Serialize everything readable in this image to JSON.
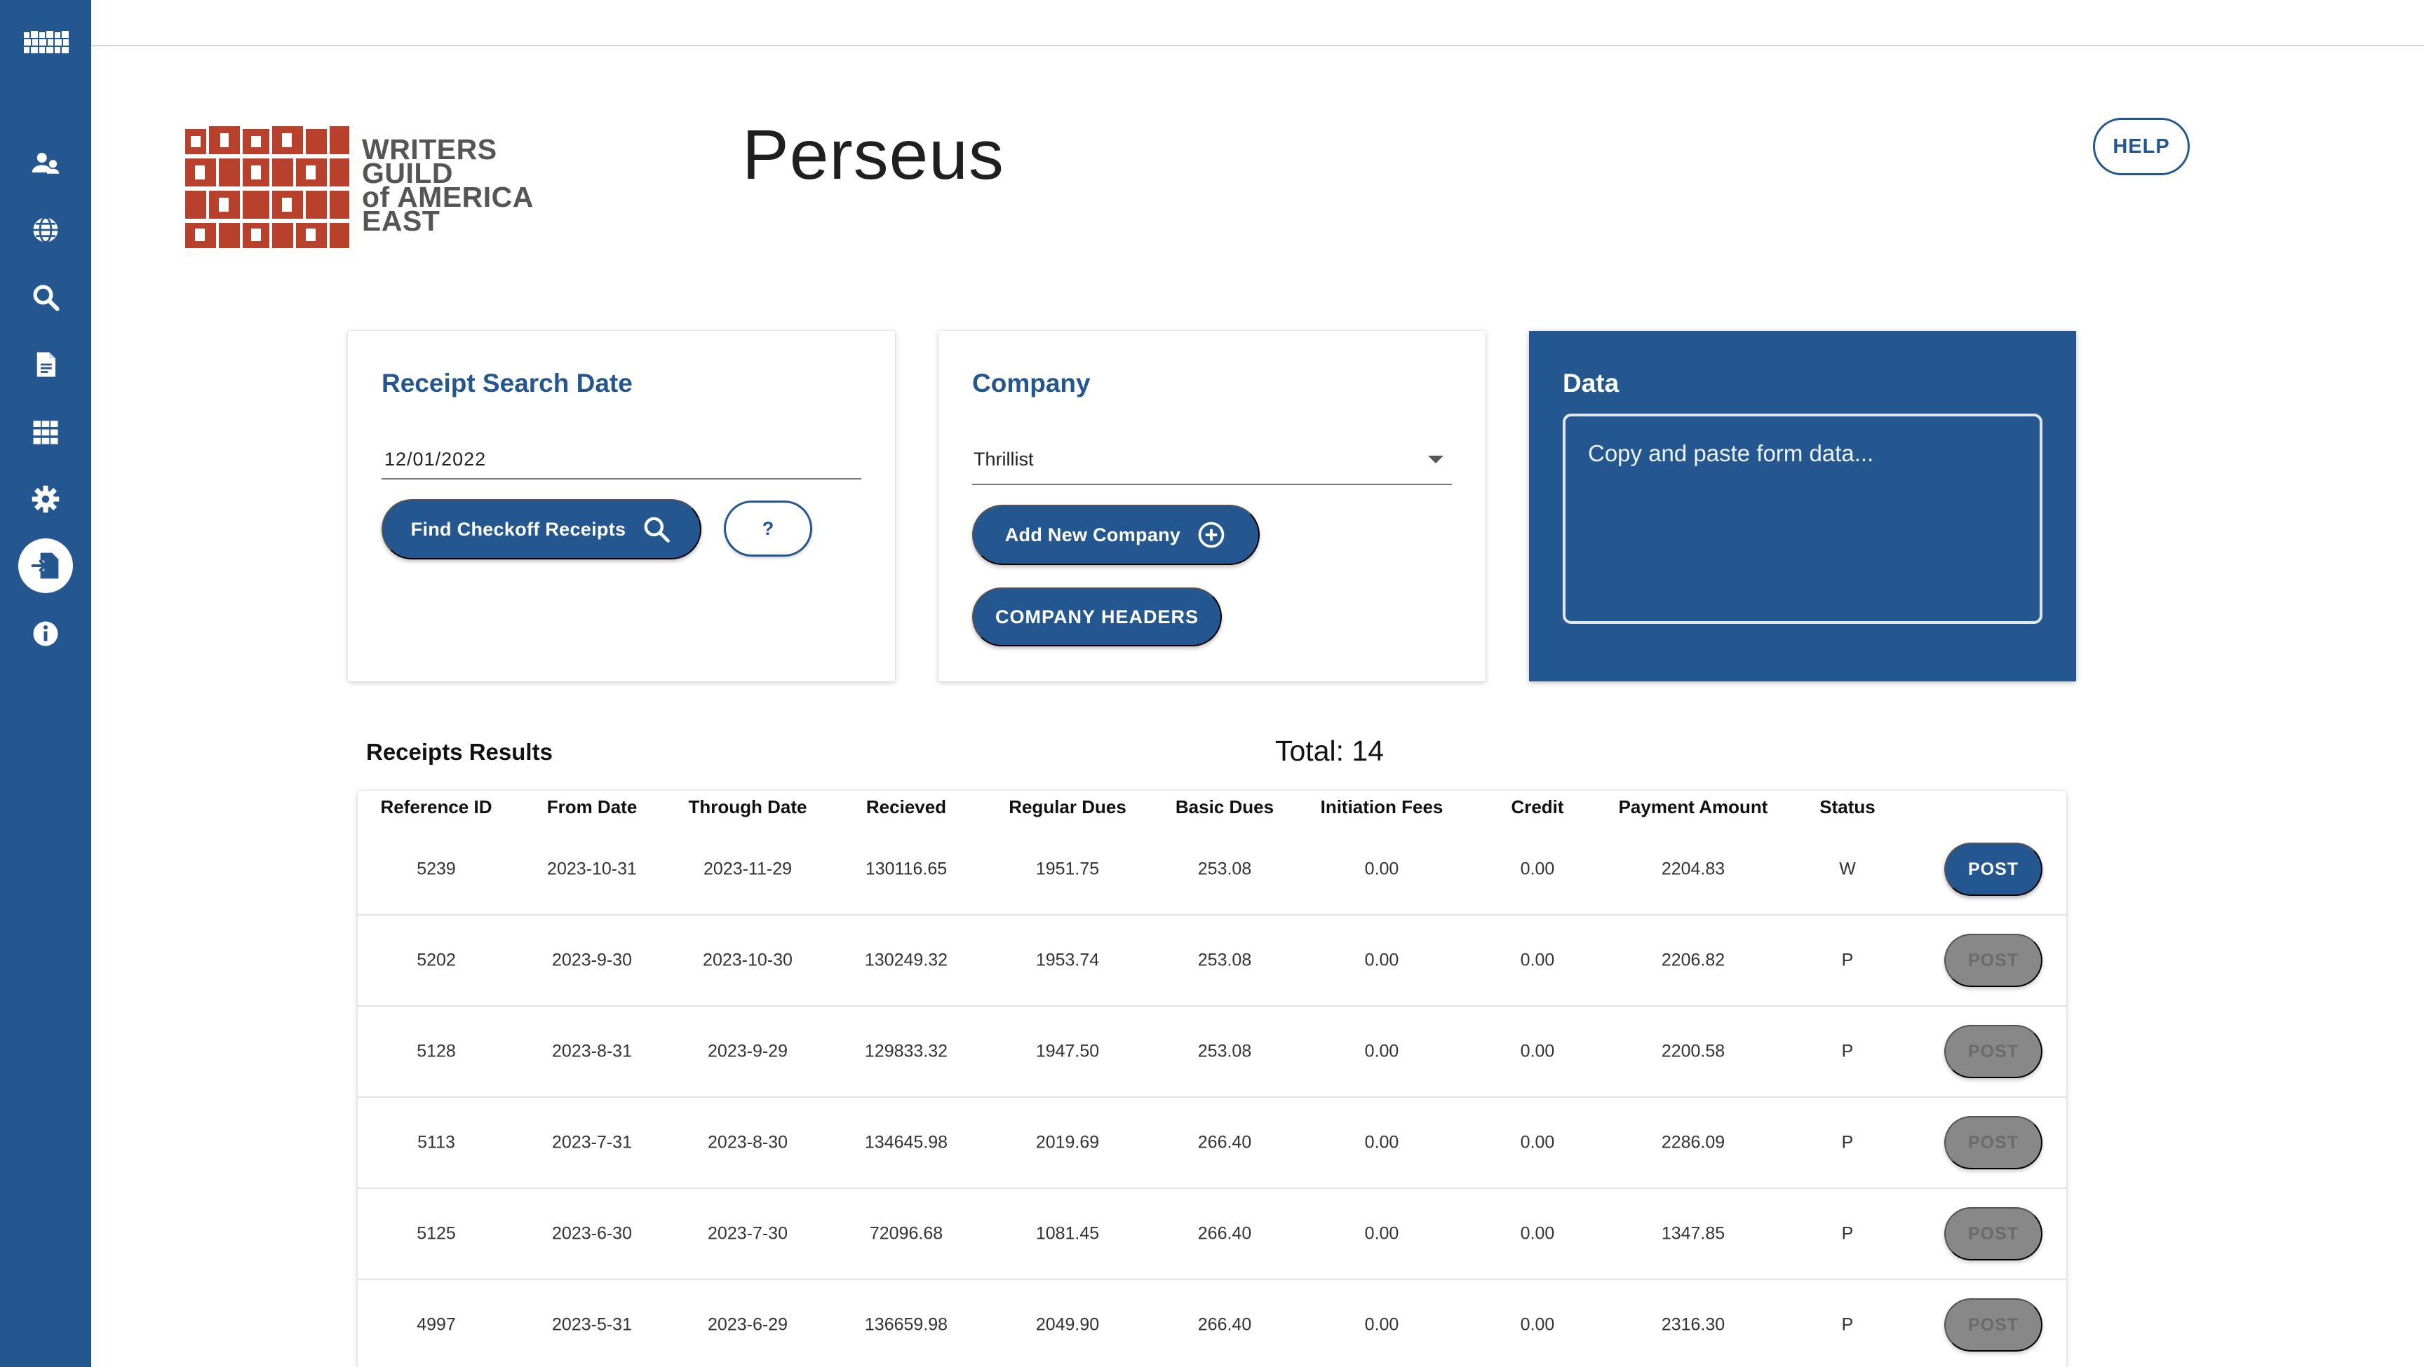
{
  "sidebar": {
    "items": [
      {
        "icon": "users-icon"
      },
      {
        "icon": "globe-icon"
      },
      {
        "icon": "search-icon"
      },
      {
        "icon": "document-icon"
      },
      {
        "icon": "grid-icon"
      },
      {
        "icon": "gear-icon"
      },
      {
        "icon": "import-icon",
        "active": true
      },
      {
        "icon": "info-icon"
      }
    ]
  },
  "header": {
    "logo_text": [
      "WRITERS",
      "GUILD",
      "of AMERICA",
      "EAST"
    ],
    "title": "Perseus",
    "help_label": "HELP"
  },
  "receipt_search": {
    "title": "Receipt Search Date",
    "date_value": "12/01/2022",
    "find_label": "Find Checkoff Receipts",
    "help_label": "?"
  },
  "company": {
    "title": "Company",
    "selected": "Thrillist",
    "add_label": "Add New Company",
    "headers_label": "COMPANY HEADERS"
  },
  "data_card": {
    "title": "Data",
    "placeholder": "Copy and paste form data..."
  },
  "results": {
    "title": "Receipts Results",
    "total": "Total: 14",
    "columns": [
      "Reference ID",
      "From Date",
      "Through Date",
      "Recieved",
      "Regular Dues",
      "Basic Dues",
      "Initiation Fees",
      "Credit",
      "Payment Amount",
      "Status"
    ],
    "rows": [
      {
        "ref": "5239",
        "from": "2023-10-31",
        "through": "2023-11-29",
        "received": "130116.65",
        "regular": "1951.75",
        "basic": "253.08",
        "initiation": "0.00",
        "credit": "0.00",
        "payment": "2204.83",
        "status": "W",
        "post": "POST",
        "post_enabled": true
      },
      {
        "ref": "5202",
        "from": "2023-9-30",
        "through": "2023-10-30",
        "received": "130249.32",
        "regular": "1953.74",
        "basic": "253.08",
        "initiation": "0.00",
        "credit": "0.00",
        "payment": "2206.82",
        "status": "P",
        "post": "POST",
        "post_enabled": false
      },
      {
        "ref": "5128",
        "from": "2023-8-31",
        "through": "2023-9-29",
        "received": "129833.32",
        "regular": "1947.50",
        "basic": "253.08",
        "initiation": "0.00",
        "credit": "0.00",
        "payment": "2200.58",
        "status": "P",
        "post": "POST",
        "post_enabled": false
      },
      {
        "ref": "5113",
        "from": "2023-7-31",
        "through": "2023-8-30",
        "received": "134645.98",
        "regular": "2019.69",
        "basic": "266.40",
        "initiation": "0.00",
        "credit": "0.00",
        "payment": "2286.09",
        "status": "P",
        "post": "POST",
        "post_enabled": false
      },
      {
        "ref": "5125",
        "from": "2023-6-30",
        "through": "2023-7-30",
        "received": "72096.68",
        "regular": "1081.45",
        "basic": "266.40",
        "initiation": "0.00",
        "credit": "0.00",
        "payment": "1347.85",
        "status": "P",
        "post": "POST",
        "post_enabled": false
      },
      {
        "ref": "4997",
        "from": "2023-5-31",
        "through": "2023-6-29",
        "received": "136659.98",
        "regular": "2049.90",
        "basic": "266.40",
        "initiation": "0.00",
        "credit": "0.00",
        "payment": "2316.30",
        "status": "P",
        "post": "POST",
        "post_enabled": false
      }
    ]
  },
  "colors": {
    "primary": "#24578f",
    "brand_red": "#b8412e",
    "disabled": "#888888"
  }
}
